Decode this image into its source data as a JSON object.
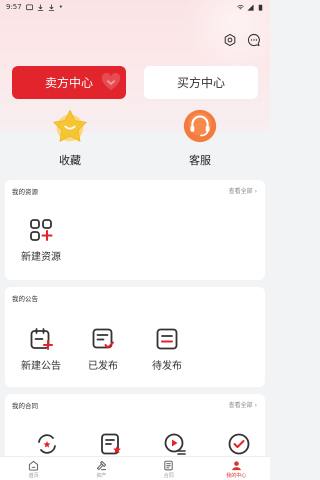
{
  "status_bar": {
    "time": "9:57"
  },
  "segment": {
    "seller_label": "卖方中心",
    "buyer_label": "买方中心"
  },
  "quick": {
    "favorites_label": "收藏",
    "service_label": "客服"
  },
  "resources": {
    "title": "我的资源",
    "more": "查看全部",
    "new_label": "新建资源"
  },
  "announcements": {
    "title": "我的公告",
    "more": "查看全部",
    "items": [
      {
        "label": "新建公告",
        "icon": "new-announcement-icon"
      },
      {
        "label": "已发布",
        "icon": "published-icon"
      },
      {
        "label": "待发布",
        "icon": "pending-publish-icon"
      }
    ]
  },
  "contracts": {
    "title": "我的合同",
    "more": "查看全部"
  },
  "tabbar": {
    "items": [
      {
        "label": "首页",
        "icon": "home-icon"
      },
      {
        "label": "资产",
        "icon": "gavel-icon"
      },
      {
        "label": "合同",
        "icon": "document-icon"
      },
      {
        "label": "我的中心",
        "icon": "user-icon"
      }
    ]
  },
  "colors": {
    "accent": "#e2242d",
    "favorite_badge": "#f6c533",
    "service_badge": "#f47a3d"
  }
}
